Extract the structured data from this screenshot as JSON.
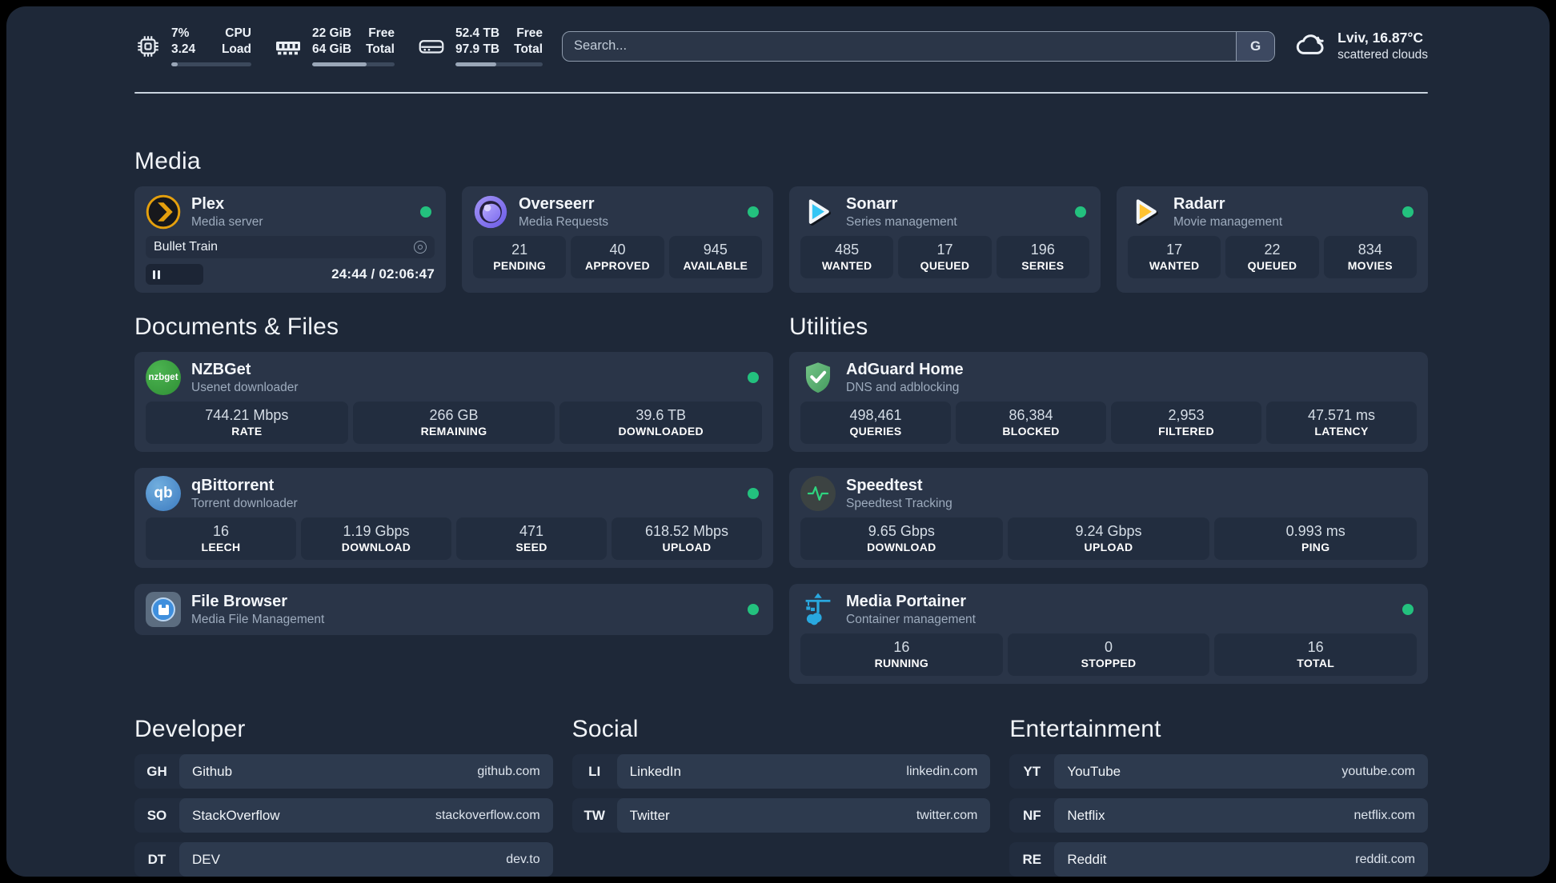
{
  "colors": {
    "background": "#1e2838",
    "card": "#2a3548",
    "tile": "#222d3f",
    "status_green": "#23c17e",
    "plex_amber": "#e5a00d",
    "sonarr_cyan": "#35c6f4",
    "radarr_yellow": "#ffc230",
    "nzbget_green": "#3aa53f",
    "qbittorrent_blue": "#4a86c8",
    "adguard_green": "#5cab6d",
    "speedtest_green": "#2ed47f",
    "portainer_blue": "#29a8df",
    "filebrowser_blue": "#3f8fdd"
  },
  "topbar": {
    "cpu": {
      "line1": "7%",
      "line2": "3.24",
      "label1": "CPU",
      "label2": "Load",
      "progress_pct": 8
    },
    "memory": {
      "line1": "22 GiB",
      "line2": "64 GiB",
      "label1": "Free",
      "label2": "Total",
      "progress_pct": 66
    },
    "disk": {
      "line1": "52.4 TB",
      "line2": "97.9 TB",
      "label1": "Free",
      "label2": "Total",
      "progress_pct": 47
    },
    "search": {
      "placeholder": "Search...",
      "button_label": "G"
    },
    "weather": {
      "location_temp": "Lviv, 16.87°C",
      "condition": "scattered clouds"
    }
  },
  "sections": {
    "media": {
      "heading": "Media",
      "cards": [
        {
          "title": "Plex",
          "subtitle": "Media server",
          "player": {
            "track": "Bullet Train",
            "time": "24:44 / 02:06:47",
            "progress_pct": 20
          }
        },
        {
          "title": "Overseerr",
          "subtitle": "Media Requests",
          "stats": [
            {
              "value": "21",
              "label": "PENDING"
            },
            {
              "value": "40",
              "label": "APPROVED"
            },
            {
              "value": "945",
              "label": "AVAILABLE"
            }
          ]
        },
        {
          "title": "Sonarr",
          "subtitle": "Series management",
          "stats": [
            {
              "value": "485",
              "label": "WANTED"
            },
            {
              "value": "17",
              "label": "QUEUED"
            },
            {
              "value": "196",
              "label": "SERIES"
            }
          ]
        },
        {
          "title": "Radarr",
          "subtitle": "Movie management",
          "stats": [
            {
              "value": "17",
              "label": "WANTED"
            },
            {
              "value": "22",
              "label": "QUEUED"
            },
            {
              "value": "834",
              "label": "MOVIES"
            }
          ]
        }
      ]
    },
    "documents": {
      "heading": "Documents & Files",
      "cards": [
        {
          "title": "NZBGet",
          "subtitle": "Usenet downloader",
          "icon_text": "nzbget",
          "stats": [
            {
              "value": "744.21 Mbps",
              "label": "RATE"
            },
            {
              "value": "266 GB",
              "label": "REMAINING"
            },
            {
              "value": "39.6 TB",
              "label": "DOWNLOADED"
            }
          ]
        },
        {
          "title": "qBittorrent",
          "subtitle": "Torrent downloader",
          "icon_text": "qb",
          "stats": [
            {
              "value": "16",
              "label": "LEECH"
            },
            {
              "value": "1.19 Gbps",
              "label": "DOWNLOAD"
            },
            {
              "value": "471",
              "label": "SEED"
            },
            {
              "value": "618.52 Mbps",
              "label": "UPLOAD"
            }
          ]
        },
        {
          "title": "File Browser",
          "subtitle": "Media File Management"
        }
      ]
    },
    "utilities": {
      "heading": "Utilities",
      "cards": [
        {
          "title": "AdGuard Home",
          "subtitle": "DNS and adblocking",
          "stats": [
            {
              "value": "498,461",
              "label": "QUERIES"
            },
            {
              "value": "86,384",
              "label": "BLOCKED"
            },
            {
              "value": "2,953",
              "label": "FILTERED"
            },
            {
              "value": "47.571 ms",
              "label": "LATENCY"
            }
          ]
        },
        {
          "title": "Speedtest",
          "subtitle": "Speedtest Tracking",
          "stats": [
            {
              "value": "9.65 Gbps",
              "label": "DOWNLOAD"
            },
            {
              "value": "9.24 Gbps",
              "label": "UPLOAD"
            },
            {
              "value": "0.993 ms",
              "label": "PING"
            }
          ]
        },
        {
          "title": "Media Portainer",
          "subtitle": "Container management",
          "stats": [
            {
              "value": "16",
              "label": "RUNNING"
            },
            {
              "value": "0",
              "label": "STOPPED"
            },
            {
              "value": "16",
              "label": "TOTAL"
            }
          ]
        }
      ]
    },
    "developer": {
      "heading": "Developer",
      "links": [
        {
          "tag": "GH",
          "name": "Github",
          "url": "github.com"
        },
        {
          "tag": "SO",
          "name": "StackOverflow",
          "url": "stackoverflow.com"
        },
        {
          "tag": "DT",
          "name": "DEV",
          "url": "dev.to"
        }
      ]
    },
    "social": {
      "heading": "Social",
      "links": [
        {
          "tag": "LI",
          "name": "LinkedIn",
          "url": "linkedin.com"
        },
        {
          "tag": "TW",
          "name": "Twitter",
          "url": "twitter.com"
        }
      ]
    },
    "entertainment": {
      "heading": "Entertainment",
      "links": [
        {
          "tag": "YT",
          "name": "YouTube",
          "url": "youtube.com"
        },
        {
          "tag": "NF",
          "name": "Netflix",
          "url": "netflix.com"
        },
        {
          "tag": "RE",
          "name": "Reddit",
          "url": "reddit.com"
        }
      ]
    }
  }
}
